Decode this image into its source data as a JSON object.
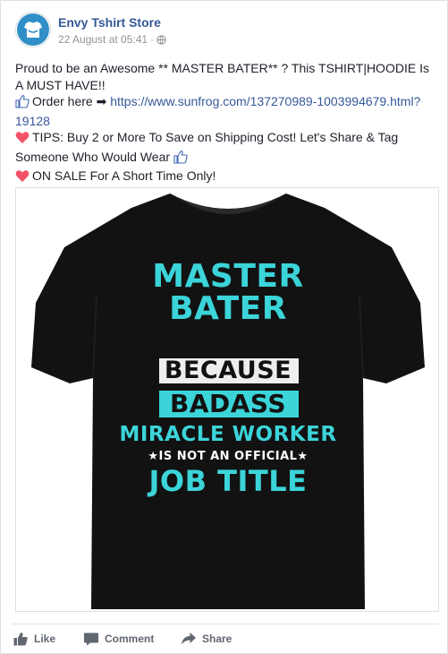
{
  "post": {
    "page_name": "Envy Tshirt Store",
    "timestamp": "22 August at 05:41",
    "privacy_icon": "globe-icon",
    "text": {
      "line1": "Proud to be an Awesome ** MASTER BATER** ? This TSHIRT|HOODIE Is A MUST HAVE!!",
      "order_label": "Order here ➡",
      "order_link": "https://www.sunfrog.com/137270989-1003994679.html?19128",
      "tips": "TIPS: Buy 2 or More To Save on Shipping Cost! Let's Share & Tag Someone Who Would Wear",
      "sale": "ON SALE For A Short Time Only!"
    },
    "shirt_print": {
      "line1": "MASTER",
      "line2": "BATER",
      "line3": "BECAUSE",
      "line4": "BADASS",
      "line5": "MIRACLE WORKER",
      "line6": "★IS NOT AN OFFICIAL★",
      "line7": "JOB TITLE"
    },
    "colors": {
      "link": "#365899",
      "heart": "#f25268",
      "cyan": "#3bd4d9",
      "shirt": "#121212"
    }
  },
  "actions": {
    "like": "Like",
    "comment": "Comment",
    "share": "Share"
  }
}
